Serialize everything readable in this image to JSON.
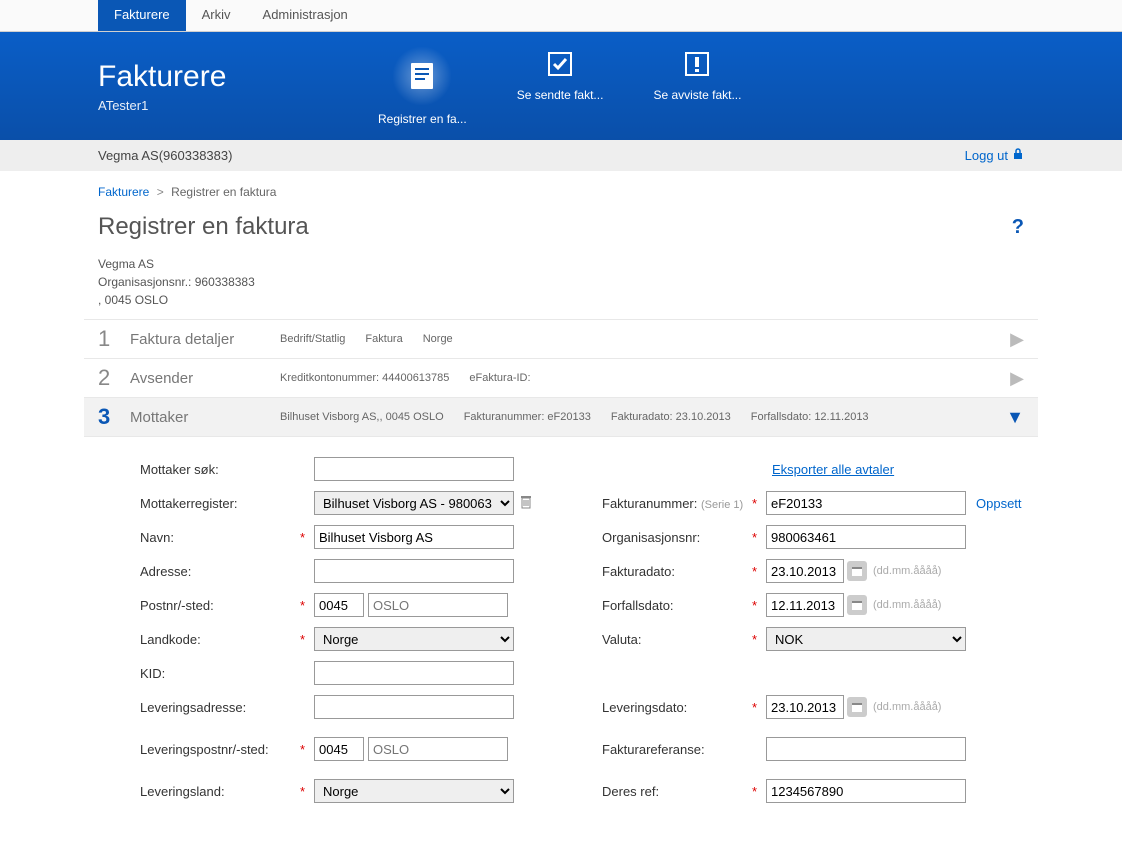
{
  "topnav": {
    "tabs": [
      {
        "label": "Fakturere",
        "active": true
      },
      {
        "label": "Arkiv",
        "active": false
      },
      {
        "label": "Administrasjon",
        "active": false
      }
    ]
  },
  "banner": {
    "title": "Fakturere",
    "subtitle": "ATester1",
    "actions": [
      {
        "label": "Registrer en fa...",
        "name": "register-invoice"
      },
      {
        "label": "Se sendte fakt...",
        "name": "view-sent"
      },
      {
        "label": "Se avviste fakt...",
        "name": "view-rejected"
      }
    ]
  },
  "subheader": {
    "company": "Vegma AS(960338383)",
    "logout": "Logg ut"
  },
  "breadcrumb": {
    "root": "Fakturere",
    "current": "Registrer en faktura"
  },
  "page_title": "Registrer en faktura",
  "company": {
    "name": "Vegma AS",
    "orgnr_label": "Organisasjonsnr.: 960338383",
    "address": ", 0045 OSLO"
  },
  "steps": [
    {
      "num": "1",
      "label": "Faktura detaljer",
      "summary": [
        "Bedrift/Statlig",
        "Faktura",
        "Norge"
      ],
      "active": false
    },
    {
      "num": "2",
      "label": "Avsender",
      "summary": [
        "Kreditkontonummer: 44400613785",
        "eFaktura-ID:"
      ],
      "active": false
    },
    {
      "num": "3",
      "label": "Mottaker",
      "summary": [
        "Bilhuset Visborg AS,, 0045 OSLO",
        "Fakturanummer: eF20133",
        "Fakturadato: 23.10.2013",
        "Forfallsdato: 12.11.2013"
      ],
      "active": true
    }
  ],
  "form": {
    "left": {
      "mottaker_sok_label": "Mottaker søk:",
      "mottaker_sok_value": "",
      "mottakerregister_label": "Mottakerregister:",
      "mottakerregister_value": "Bilhuset Visborg AS - 980063",
      "navn_label": "Navn:",
      "navn_value": "Bilhuset Visborg AS",
      "adresse_label": "Adresse:",
      "adresse_value": "",
      "postnr_label": "Postnr/-sted:",
      "postnr_value": "0045",
      "sted_placeholder": "OSLO",
      "landkode_label": "Landkode:",
      "landkode_value": "Norge",
      "kid_label": "KID:",
      "kid_value": "",
      "leveringsadresse_label": "Leveringsadresse:",
      "leveringsadresse_value": "",
      "leveringspostnr_label": "Leveringspostnr/-sted:",
      "leveringspostnr_value": "0045",
      "leveringssted_placeholder": "OSLO",
      "leveringsland_label": "Leveringsland:",
      "leveringsland_value": "Norge"
    },
    "right": {
      "eksporter_link": "Eksporter alle avtaler",
      "fakturanummer_label": "Fakturanummer:",
      "fakturanummer_series": "(Serie 1)",
      "fakturanummer_value": "eF20133",
      "oppsett_link": "Oppsett",
      "orgnr_label": "Organisasjonsnr:",
      "orgnr_value": "980063461",
      "fakturadato_label": "Fakturadato:",
      "fakturadato_value": "23.10.2013",
      "forfallsdato_label": "Forfallsdato:",
      "forfallsdato_value": "12.11.2013",
      "valuta_label": "Valuta:",
      "valuta_value": "NOK",
      "leveringsdato_label": "Leveringsdato:",
      "leveringsdato_value": "23.10.2013",
      "fakturareferanse_label": "Fakturareferanse:",
      "fakturareferanse_value": "",
      "deres_ref_label": "Deres ref:",
      "deres_ref_value": "1234567890",
      "date_hint": "(dd.mm.åååå)"
    }
  }
}
